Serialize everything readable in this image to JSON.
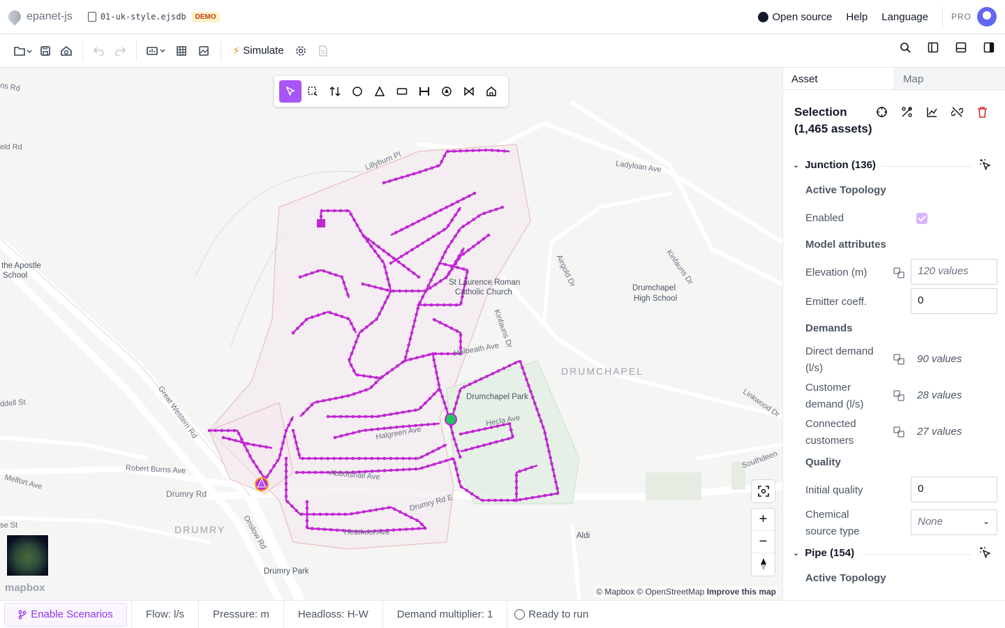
{
  "header": {
    "app_name": "epanet-js",
    "file_name": "01-uk-style.ejsdb",
    "badge": "DEMO",
    "open_source": "Open source",
    "help": "Help",
    "language": "Language",
    "plan": "PRO"
  },
  "toolbar": {
    "simulate": "Simulate"
  },
  "map": {
    "labels": {
      "ns_rd": "ns Rd",
      "eld_rd": "eld Rd",
      "lillyburn": "Lillyburn Pl",
      "ladyloan": "Ladyloan Ave",
      "apostle": "the Apostle",
      "school": "School",
      "airgold": "Airgold Dr",
      "kinfauns_dr": "Kinfauns Dr",
      "st_laurence": "St Laurence Roman",
      "catholic": "Catholic Church",
      "drumchapel_high": "Drumchapel",
      "high_school": "High School",
      "kinfauns2": "Kinfauns Dr",
      "halbeath": "Halbeath Ave",
      "drumchapel": "DRUMCHAPEL",
      "drumchapel_park": "Drumchapel Park",
      "dell_st": "ddell St",
      "great_western": "Great Western Rd",
      "linkwood": "Linkwood Dr",
      "robert_burns": "Robert Burns Ave",
      "melfort": "Melfort Ave",
      "drumry_rd": "Drumry Rd",
      "southdeen": "Southdeen",
      "se_st": "se St",
      "drumry": "DRUMRY",
      "onslow": "Onslow Rd",
      "aldi": "Aldi",
      "drumry_park": "Drumry Park",
      "abbotshall": "Abbotshall Ave",
      "drumry_rd_e": "Drumry Rd E",
      "heathcot": "Heathcot Ave",
      "hecla": "Hecla Ave",
      "halgreen": "Halgreen Ave"
    },
    "attribution": "© Mapbox © OpenStreetMap",
    "improve": "Improve this map",
    "mapbox_logo": "mapbox"
  },
  "panel": {
    "tabs": [
      "Asset",
      "Map"
    ],
    "selection_title": "Selection",
    "selection_count": "(1,465 assets)",
    "junction_head": "Junction (136)",
    "active_topology": "Active Topology",
    "enabled": "Enabled",
    "model_attributes": "Model attributes",
    "elevation_label": "Elevation (m)",
    "elevation_value": "120 values",
    "emitter_label": "Emitter coeff.",
    "emitter_value": "0",
    "demands": "Demands",
    "direct_demand_label": "Direct demand (l/s)",
    "direct_demand_value": "90 values",
    "customer_demand_label": "Customer demand (l/s)",
    "customer_demand_value": "28 values",
    "connected_label": "Connected customers",
    "connected_value": "27 values",
    "quality": "Quality",
    "initial_quality_label": "Initial quality",
    "initial_quality_value": "0",
    "chemical_label": "Chemical source type",
    "chemical_value": "None",
    "pipe_head": "Pipe (154)",
    "pipe_active_topology": "Active Topology"
  },
  "footer": {
    "scenarios": "Enable Scenarios",
    "flow": "Flow: l/s",
    "pressure": "Pressure: m",
    "headloss": "Headloss: H-W",
    "demand_multiplier": "Demand multiplier: 1",
    "status": "Ready to run"
  },
  "colors": {
    "accent": "#a855f7",
    "network": "#c026d3"
  }
}
